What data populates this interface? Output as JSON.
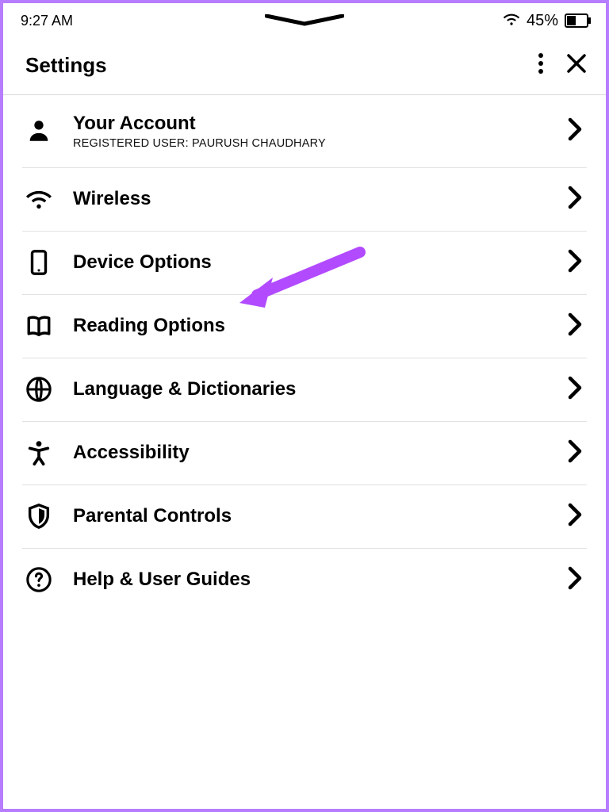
{
  "status_bar": {
    "time": "9:27 AM",
    "battery_percent": "45%"
  },
  "header": {
    "title": "Settings"
  },
  "menu": {
    "account": {
      "title": "Your Account",
      "subtitle": "REGISTERED USER: PAURUSH CHAUDHARY"
    },
    "wireless": {
      "title": "Wireless"
    },
    "device_options": {
      "title": "Device Options"
    },
    "reading_options": {
      "title": "Reading Options"
    },
    "language": {
      "title": "Language & Dictionaries"
    },
    "accessibility": {
      "title": "Accessibility"
    },
    "parental": {
      "title": "Parental Controls"
    },
    "help": {
      "title": "Help & User Guides"
    }
  },
  "annotation": {
    "arrow_color": "#b24bff"
  }
}
